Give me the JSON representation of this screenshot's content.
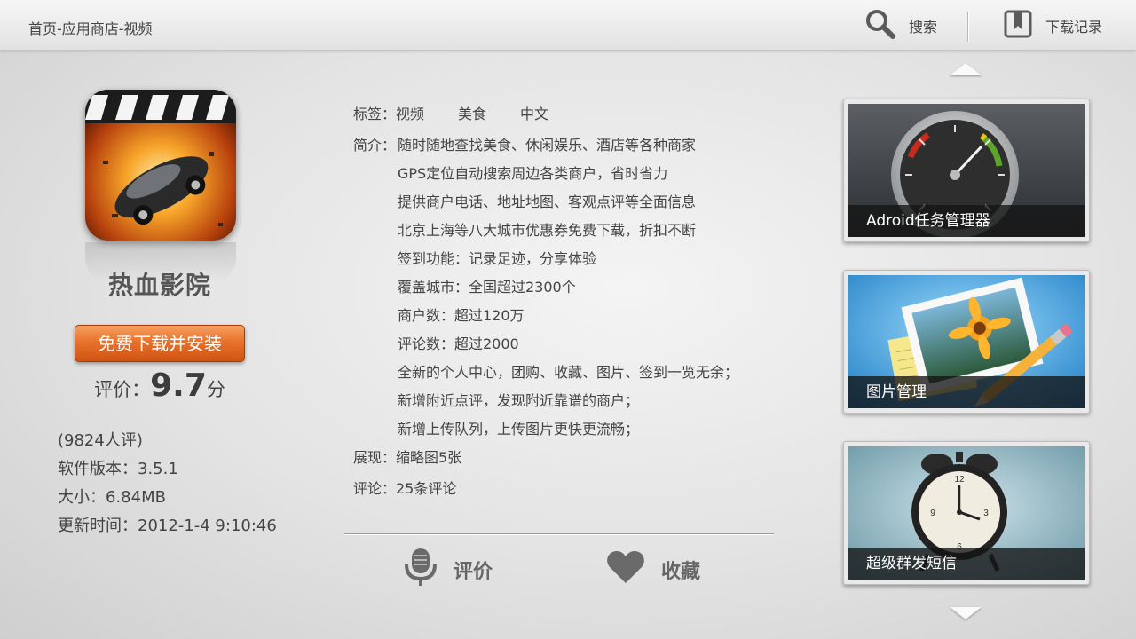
{
  "header": {
    "breadcrumb": "首页-应用商店-视频",
    "search_label": "搜索",
    "downloads_label": "下载记录"
  },
  "app": {
    "name": "热血影院",
    "install_label": "免费下载并安装",
    "rating_label": "评价：",
    "rating_value": "9.7",
    "rating_unit": "分",
    "reviews_count": "(9824人评)",
    "version": "软件版本：3.5.1",
    "size": "大小：6.84MB",
    "updated": "更新时间：2012-1-4 9:10:46"
  },
  "details": {
    "tags_label": "标签：",
    "tags": [
      "视频",
      "美食",
      "中文"
    ],
    "intro_label": "简介：",
    "intro_lines": [
      "随时随地查找美食、休闲娱乐、酒店等各种商家",
      "GPS定位自动搜索周边各类商户，省时省力",
      "提供商户电话、地址地图、客观点评等全面信息",
      "北京上海等八大城市优惠券免费下载，折扣不断",
      "签到功能：记录足迹，分享体验",
      "覆盖城市：全国超过2300个",
      "商户数：超过120万",
      "评论数：超过2000",
      "全新的个人中心，团购、收藏、图片、签到一览无余；",
      "新增附近点评，发现附近靠谱的商户；",
      "新增上传队列，上传图片更快更流畅；"
    ],
    "screenshots": "展现：缩略图5张",
    "comments": "评论：25条评论"
  },
  "actions": {
    "rate_label": "评价",
    "favorite_label": "收藏"
  },
  "related": [
    {
      "title": "Adroid任务管理器",
      "icon": "airspeed-gauge-icon"
    },
    {
      "title": "图片管理",
      "icon": "photo-frame-pencil-icon"
    },
    {
      "title": "超级群发短信",
      "icon": "alarm-clock-icon"
    }
  ],
  "colors": {
    "install_button": "#e8722c",
    "caption_bg": "#141414"
  }
}
